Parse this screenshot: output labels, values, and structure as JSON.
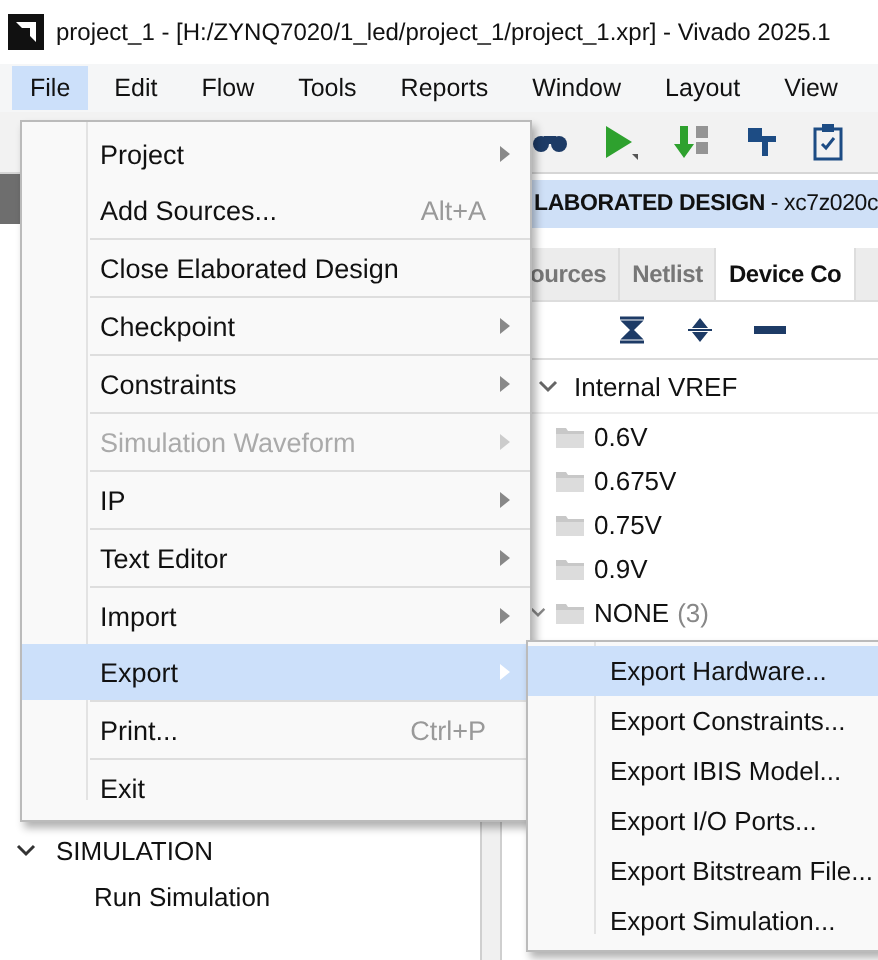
{
  "window": {
    "title": "project_1 - [H:/ZYNQ7020/1_led/project_1/project_1.xpr] - Vivado 2025.1"
  },
  "menubar": [
    {
      "label": "File",
      "selected": true
    },
    {
      "label": "Edit",
      "selected": false
    },
    {
      "label": "Flow",
      "selected": false
    },
    {
      "label": "Tools",
      "selected": false
    },
    {
      "label": "Reports",
      "selected": false
    },
    {
      "label": "Window",
      "selected": false
    },
    {
      "label": "Layout",
      "selected": false
    },
    {
      "label": "View",
      "selected": false
    }
  ],
  "flow_navigator": {
    "sections": [
      {
        "label": "SIMULATION",
        "expanded": true,
        "children": [
          {
            "label": "Run Simulation"
          }
        ]
      }
    ]
  },
  "design_panel": {
    "header": {
      "title": "**LABORATED DESIGN** - xc7z020c"
    },
    "tabs": [
      {
        "label": "ources",
        "selected": false
      },
      {
        "label": "Netlist",
        "selected": false
      },
      {
        "label": "Device Co",
        "selected": true
      }
    ],
    "tree": [
      {
        "label": "Internal VREF",
        "expanded": true,
        "children": [
          {
            "label": "0.6V",
            "kind": "leaf"
          },
          {
            "label": "0.675V",
            "kind": "leaf"
          },
          {
            "label": "0.75V",
            "kind": "leaf"
          },
          {
            "label": "0.9V",
            "kind": "leaf"
          },
          {
            "label": "NONE",
            "count": "(3)",
            "kind": "group",
            "expanded": true
          }
        ]
      }
    ]
  },
  "file_menu": [
    {
      "label": "Project",
      "submenu": true,
      "disabled": false,
      "selected": false,
      "group_start": false
    },
    {
      "label": "Add Sources...",
      "shortcut": "Alt+A",
      "submenu": false,
      "disabled": false,
      "selected": false,
      "group_start": false
    },
    {
      "label": "Close Elaborated Design",
      "submenu": false,
      "disabled": false,
      "selected": false,
      "group_start": true
    },
    {
      "label": "Checkpoint",
      "submenu": true,
      "disabled": false,
      "selected": false,
      "group_start": true
    },
    {
      "label": "Constraints",
      "submenu": true,
      "disabled": false,
      "selected": false,
      "group_start": true
    },
    {
      "label": "Simulation Waveform",
      "submenu": true,
      "disabled": true,
      "selected": false,
      "group_start": true
    },
    {
      "label": "IP",
      "submenu": true,
      "disabled": false,
      "selected": false,
      "group_start": true
    },
    {
      "label": "Text Editor",
      "submenu": true,
      "disabled": false,
      "selected": false,
      "group_start": true
    },
    {
      "label": "Import",
      "submenu": true,
      "disabled": false,
      "selected": false,
      "group_start": true
    },
    {
      "label": "Export",
      "submenu": true,
      "disabled": false,
      "selected": true,
      "group_start": false
    },
    {
      "label": "Print...",
      "shortcut": "Ctrl+P",
      "submenu": false,
      "disabled": false,
      "selected": false,
      "group_start": true
    },
    {
      "label": "Exit",
      "submenu": false,
      "disabled": false,
      "selected": false,
      "group_start": true
    }
  ],
  "export_submenu": [
    {
      "label": "Export Hardware...",
      "selected": true
    },
    {
      "label": "Export Constraints...",
      "selected": false
    },
    {
      "label": "Export IBIS Model...",
      "selected": false
    },
    {
      "label": "Export I/O Ports...",
      "selected": false
    },
    {
      "label": "Export Bitstream File...",
      "selected": false
    },
    {
      "label": "Export Simulation...",
      "selected": false
    }
  ]
}
